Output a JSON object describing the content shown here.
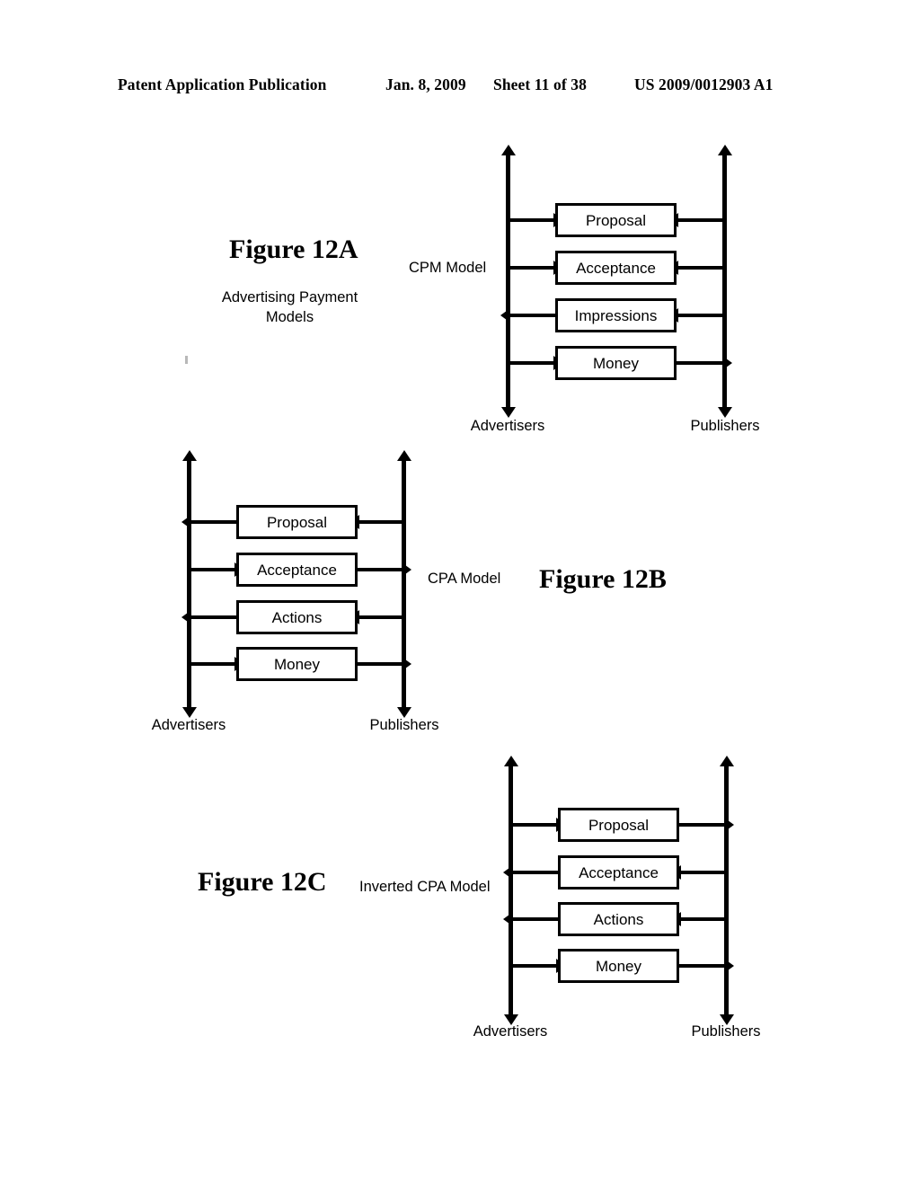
{
  "header": {
    "publication": "Patent Application Publication",
    "date": "Jan. 8, 2009",
    "sheet": "Sheet 11 of 38",
    "patent_number": "US 2009/0012903 A1"
  },
  "figures": [
    {
      "id": "12a",
      "title": "Figure 12A",
      "subtitle": "Advertising Payment\nModels",
      "model_label": "CPM Model",
      "left_actor": "Advertisers",
      "right_actor": "Publishers",
      "rows": [
        {
          "label": "Proposal",
          "left_dir": "to-box",
          "right_dir": "to-box"
        },
        {
          "label": "Acceptance",
          "left_dir": "to-box",
          "right_dir": "to-box"
        },
        {
          "label": "Impressions",
          "left_dir": "to-axis",
          "right_dir": "to-box"
        },
        {
          "label": "Money",
          "left_dir": "to-box",
          "right_dir": "to-axis"
        }
      ]
    },
    {
      "id": "12b",
      "title": "Figure 12B",
      "subtitle": "",
      "model_label": "CPA Model",
      "left_actor": "Advertisers",
      "right_actor": "Publishers",
      "rows": [
        {
          "label": "Proposal",
          "left_dir": "to-axis",
          "right_dir": "to-box"
        },
        {
          "label": "Acceptance",
          "left_dir": "to-box",
          "right_dir": "to-axis"
        },
        {
          "label": "Actions",
          "left_dir": "to-axis",
          "right_dir": "to-box"
        },
        {
          "label": "Money",
          "left_dir": "to-box",
          "right_dir": "to-axis"
        }
      ]
    },
    {
      "id": "12c",
      "title": "Figure 12C",
      "subtitle": "",
      "model_label": "Inverted CPA Model",
      "left_actor": "Advertisers",
      "right_actor": "Publishers",
      "rows": [
        {
          "label": "Proposal",
          "left_dir": "to-box",
          "right_dir": "to-axis"
        },
        {
          "label": "Acceptance",
          "left_dir": "to-axis",
          "right_dir": "to-box"
        },
        {
          "label": "Actions",
          "left_dir": "to-axis",
          "right_dir": "to-box"
        },
        {
          "label": "Money",
          "left_dir": "to-box",
          "right_dir": "to-axis"
        }
      ]
    }
  ]
}
